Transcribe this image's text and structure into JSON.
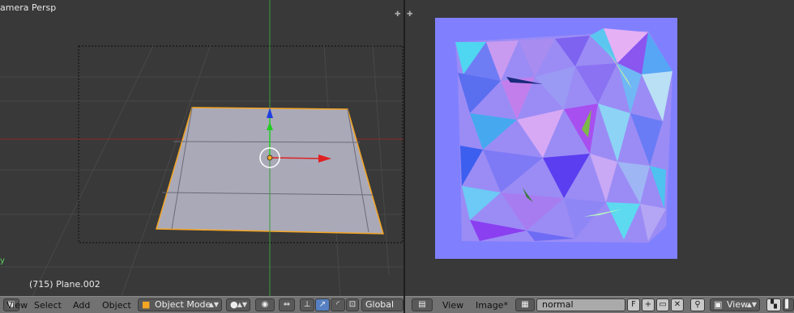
{
  "viewport3d": {
    "title": "amera Persp",
    "object_info": "(715) Plane.002",
    "axis_label": "y"
  },
  "header_3d": {
    "menu": [
      "View",
      "Select",
      "Add",
      "Object"
    ],
    "mode": "Object Mode",
    "orientation": "Global"
  },
  "image_editor": {
    "menu": [
      "View",
      "Image*"
    ],
    "image_name": "normal",
    "fake_user": "F",
    "view_menu": "View"
  },
  "colors": {
    "background": "#393939",
    "header": "#727272",
    "normal_base": "#8080ff",
    "plane": "#aaa9b8",
    "selection": "#f5a623"
  }
}
